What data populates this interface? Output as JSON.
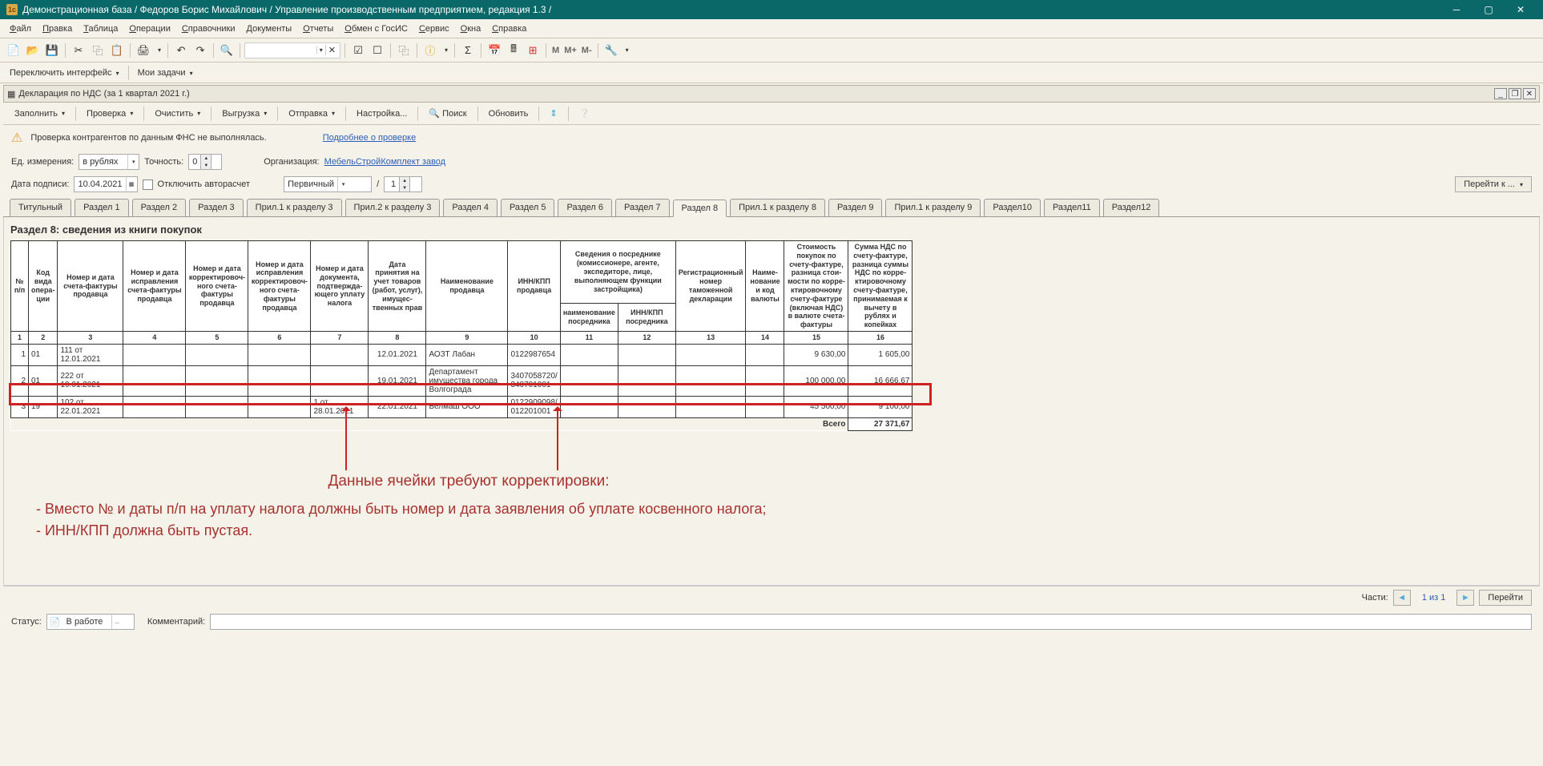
{
  "titlebar": "Демонстрационная база / Федоров Борис Михайлович / Управление производственным предприятием, редакция 1.3 /",
  "menu": [
    "Файл",
    "Правка",
    "Таблица",
    "Операции",
    "Справочники",
    "Документы",
    "Отчеты",
    "Обмен с ГосИС",
    "Сервис",
    "Окна",
    "Справка"
  ],
  "subbar": {
    "switch": "Переключить интерфейс",
    "tasks": "Мои задачи"
  },
  "doc": {
    "title": "Декларация по НДС (за 1 квартал 2021 г.)"
  },
  "docToolbar": {
    "fill": "Заполнить",
    "check": "Проверка",
    "clear": "Очистить",
    "export": "Выгрузка",
    "send": "Отправка",
    "settings": "Настройка...",
    "search": "Поиск",
    "refresh": "Обновить"
  },
  "warn": {
    "text": "Проверка контрагентов по данным ФНС не выполнялась.",
    "link": "Подробнее о проверке"
  },
  "form": {
    "unitLabel": "Ед. измерения:",
    "unitVal": "в рублях",
    "precLabel": "Точность:",
    "precVal": "0",
    "orgLabel": "Организация:",
    "orgVal": "МебельСтройКомплект завод",
    "dateLabel": "Дата подписи:",
    "dateVal": "10.04.2021",
    "autoCalc": "Отключить авторасчет",
    "primary": "Первичный",
    "num": "1",
    "goto": "Перейти к ..."
  },
  "tabs": [
    "Титульный",
    "Раздел 1",
    "Раздел 2",
    "Раздел 3",
    "Прил.1 к разделу 3",
    "Прил.2 к разделу 3",
    "Раздел 4",
    "Раздел 5",
    "Раздел 6",
    "Раздел 7",
    "Раздел 8",
    "Прил.1 к разделу 8",
    "Раздел 9",
    "Прил.1 к разделу 9",
    "Раздел10",
    "Раздел11",
    "Раздел12"
  ],
  "activeTab": 10,
  "section": {
    "title": "Раздел 8: сведения из книги покупок"
  },
  "headers": {
    "c1": "№ п/п",
    "c2": "Код вида опера-ции",
    "c3": "Номер и дата счета-фактуры продавца",
    "c4": "Номер и дата исправления счета-фактуры продавца",
    "c5": "Номер и дата корректировоч-ного счета-фактуры продавца",
    "c6": "Номер и дата исправления корректировоч-ного счета-фактуры продавца",
    "c7": "Номер и дата документа, подтвержда-ющего уплату налога",
    "c8": "Дата принятия на учет товаров (работ, услуг), имущес-твенных прав",
    "c9": "Наименование продавца",
    "c10": "ИНН/КПП продавца",
    "c11g": "Сведения о посреднике (комиссионере, агенте, экспедиторе, лице, выполняющем функции застройщика)",
    "c11": "наименование посредника",
    "c12": "ИНН/КПП посредника",
    "c13": "Регистрационный номер таможенной декларации",
    "c14": "Наиме-нование и код валюты",
    "c15": "Стоимость покупок по счету-фактуре, разница стои-мости по корре-ктировочному счету-фактуре (включая НДС) в валюте счета-фактуры",
    "c16": "Сумма НДС по счету-фактуре, разница суммы НДС по корре-ктировочному счету-фактуре, принимаемая к вычету в рублях и копейках"
  },
  "colNums": [
    "1",
    "2",
    "3",
    "4",
    "5",
    "6",
    "7",
    "8",
    "9",
    "10",
    "11",
    "12",
    "13",
    "14",
    "15",
    "16"
  ],
  "rows": [
    {
      "n": "1",
      "code": "01",
      "c3": "111 от 12.01.2021",
      "c7": "",
      "c8": "12.01.2021",
      "c9": "АОЗТ Лабан",
      "c10": "0122987654",
      "c15": "9 630,00",
      "c16": "1 605,00"
    },
    {
      "n": "2",
      "code": "01",
      "c3": "222 от 19.01.2021",
      "c7": "",
      "c8": "19.01.2021",
      "c9": "Департамент имущества города Волгограда",
      "c10": "3407058720/ 340701001",
      "c15": "100 000,00",
      "c16": "16 666,67"
    },
    {
      "n": "3",
      "code": "19",
      "c3": "102 от 22.01.2021",
      "c7": "1 от 28.01.2021",
      "c8": "22.01.2021",
      "c9": "Белмаш ООО",
      "c10": "0122909098/ 012201001",
      "c15": "45 500,00",
      "c16": "9 100,00"
    }
  ],
  "total": {
    "label": "Всего",
    "val": "27 371,67"
  },
  "annot": {
    "title": "Данные ячейки требуют корректировки:",
    "l1": "- Вместо № и даты п/п на уплату налога должны быть номер и дата  заявления об уплате косвенного налога;",
    "l2": "- ИНН/КПП должна быть пустая."
  },
  "footer": {
    "parts": "Части:",
    "pageInfo": "1 из 1",
    "go": "Перейти"
  },
  "status": {
    "label": "Статус:",
    "val": "В работе",
    "comment": "Комментарий:"
  }
}
